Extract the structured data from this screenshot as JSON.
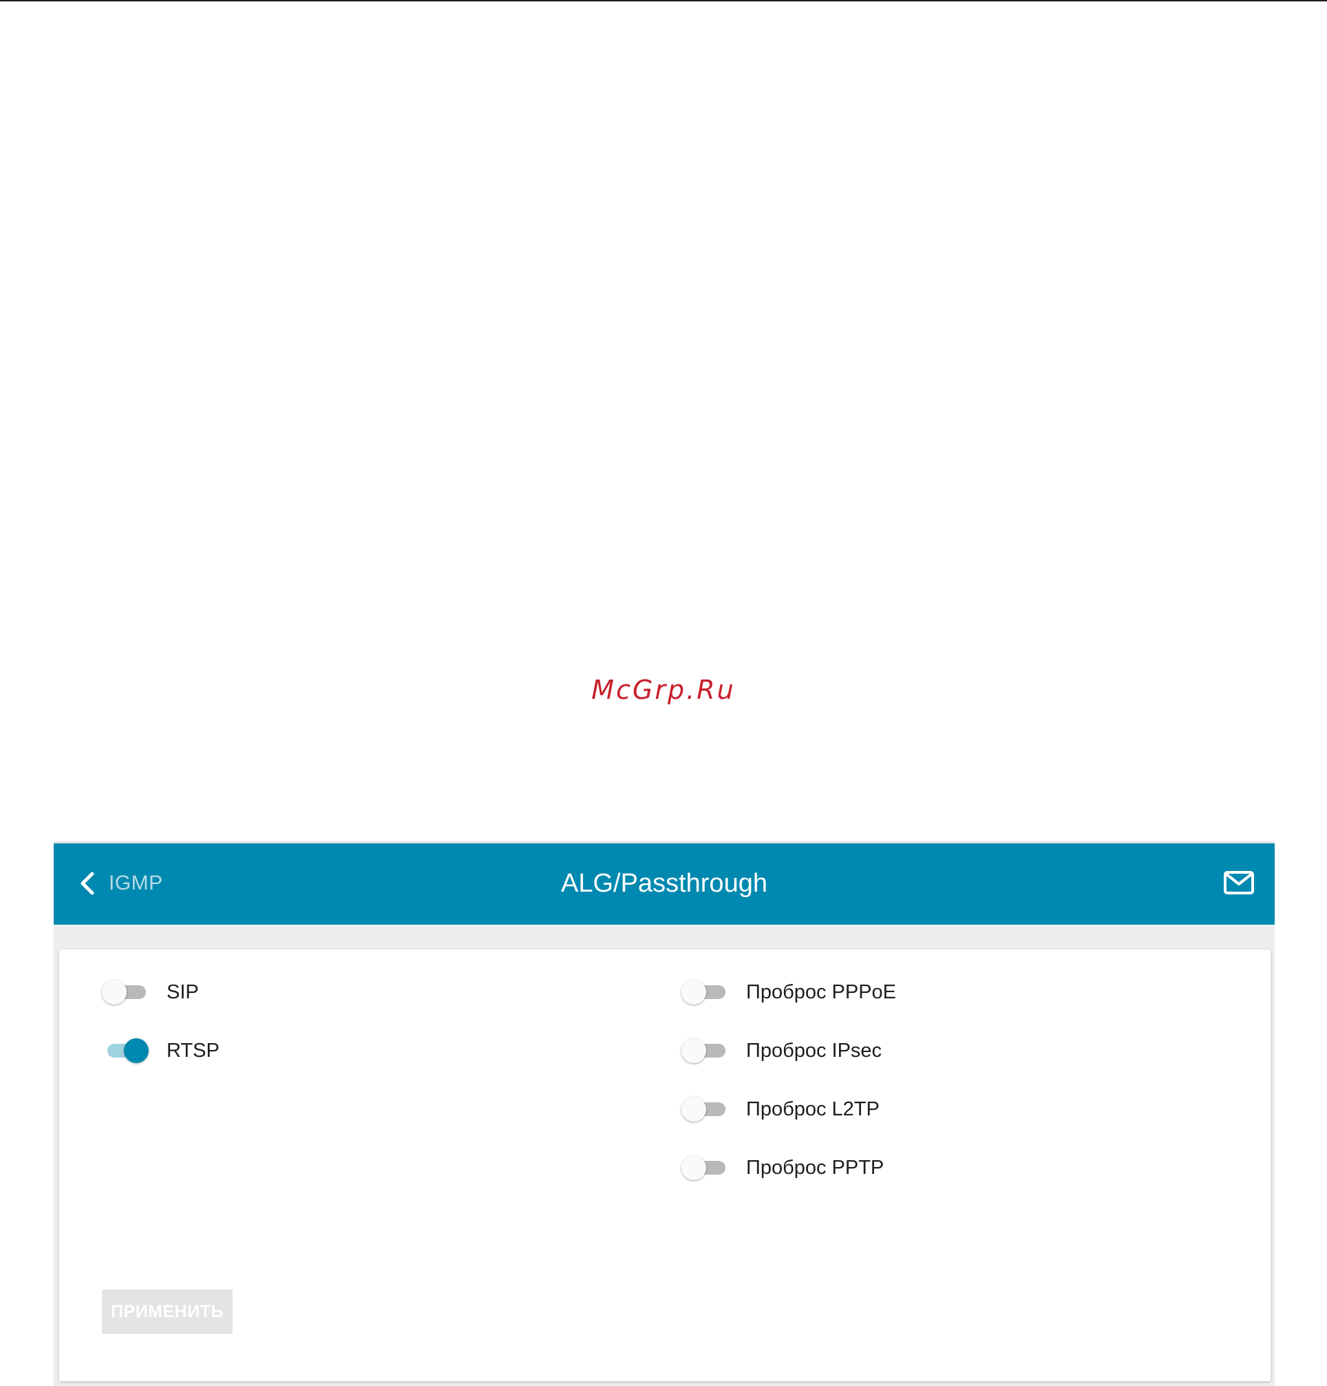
{
  "watermark": "McGrp.Ru",
  "header": {
    "back_label": "IGMP",
    "title": "ALG/Passthrough",
    "mail_icon": "envelope-icon"
  },
  "colors": {
    "accent": "#0089b0",
    "toggle_on_track": "#9fd2e1",
    "toggle_off_track": "#b9b9b9",
    "apply_disabled": "#e4e4e4",
    "watermark": "#c8202c"
  },
  "toggles_left": [
    {
      "label": "SIP",
      "checked": false
    },
    {
      "label": "RTSP",
      "checked": true
    }
  ],
  "toggles_right": [
    {
      "label": "Проброс PPPoE",
      "checked": false
    },
    {
      "label": "Проброс IPsec",
      "checked": false
    },
    {
      "label": "Проброс L2TP",
      "checked": false
    },
    {
      "label": "Проброс PPTP",
      "checked": false
    }
  ],
  "apply": {
    "label": "ПРИМЕНИТЬ",
    "disabled": true
  }
}
